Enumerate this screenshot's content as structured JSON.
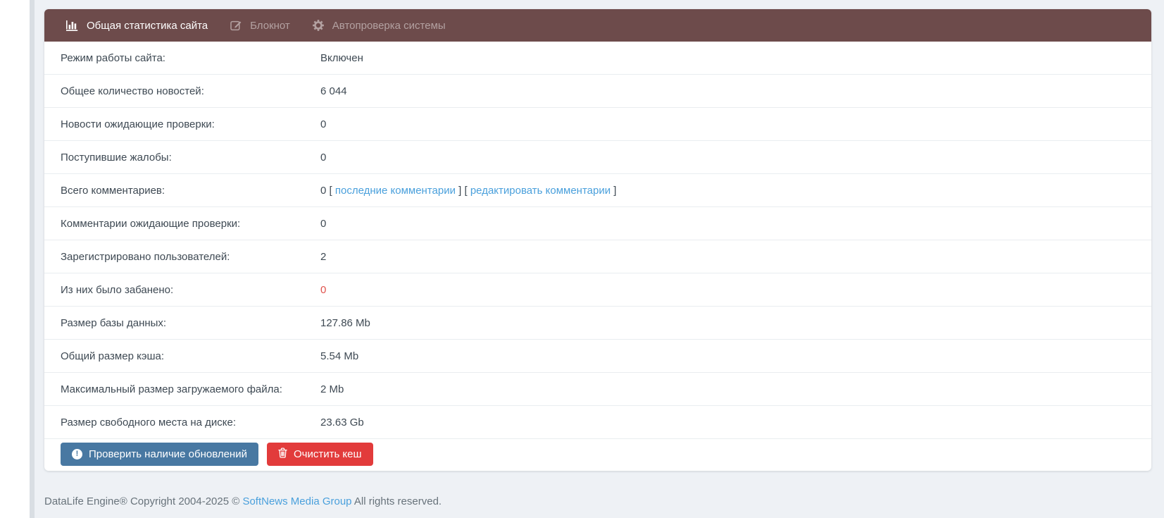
{
  "tabs": [
    {
      "label": "Общая статистика сайта",
      "icon": "bar-chart-icon",
      "active": true
    },
    {
      "label": "Блокнот",
      "icon": "edit-icon",
      "active": false
    },
    {
      "label": "Автопроверка системы",
      "icon": "gear-icon",
      "active": false
    }
  ],
  "stats": {
    "rows": [
      {
        "label": "Режим работы сайта:",
        "value": "Включен"
      },
      {
        "label": "Общее количество новостей:",
        "value": "6 044"
      },
      {
        "label": "Новости ожидающие проверки:",
        "value": "0"
      },
      {
        "label": "Поступившие жалобы:",
        "value": "0"
      },
      {
        "label": "Всего комментариев:",
        "value": "0",
        "links": [
          "последние комментарии",
          "редактировать комментарии"
        ]
      },
      {
        "label": "Комментарии ожидающие проверки:",
        "value": "0"
      },
      {
        "label": "Зарегистрировано пользователей:",
        "value": "2"
      },
      {
        "label": "Из них было забанено:",
        "value": "0",
        "danger": true
      },
      {
        "label": "Размер базы данных:",
        "value": "127.86 Mb"
      },
      {
        "label": "Общий размер кэша:",
        "value": "5.54 Mb"
      },
      {
        "label": "Максимальный размер загружаемого файла:",
        "value": "2 Mb"
      },
      {
        "label": "Размер свободного места на диске:",
        "value": "23.63 Gb"
      }
    ]
  },
  "buttons": {
    "check_updates": "Проверить наличие обновлений",
    "clear_cache": "Очистить кеш"
  },
  "footer": {
    "text_before": "DataLife Engine® Copyright 2004-2025 © ",
    "link": "SoftNews Media Group",
    "text_after": " All rights reserved."
  },
  "colors": {
    "header_bg": "#6d4b4b",
    "link_blue": "#4aa0dc",
    "danger_text": "#e0524c",
    "btn_primary": "#4878a2",
    "btn_danger": "#e23b3b"
  }
}
